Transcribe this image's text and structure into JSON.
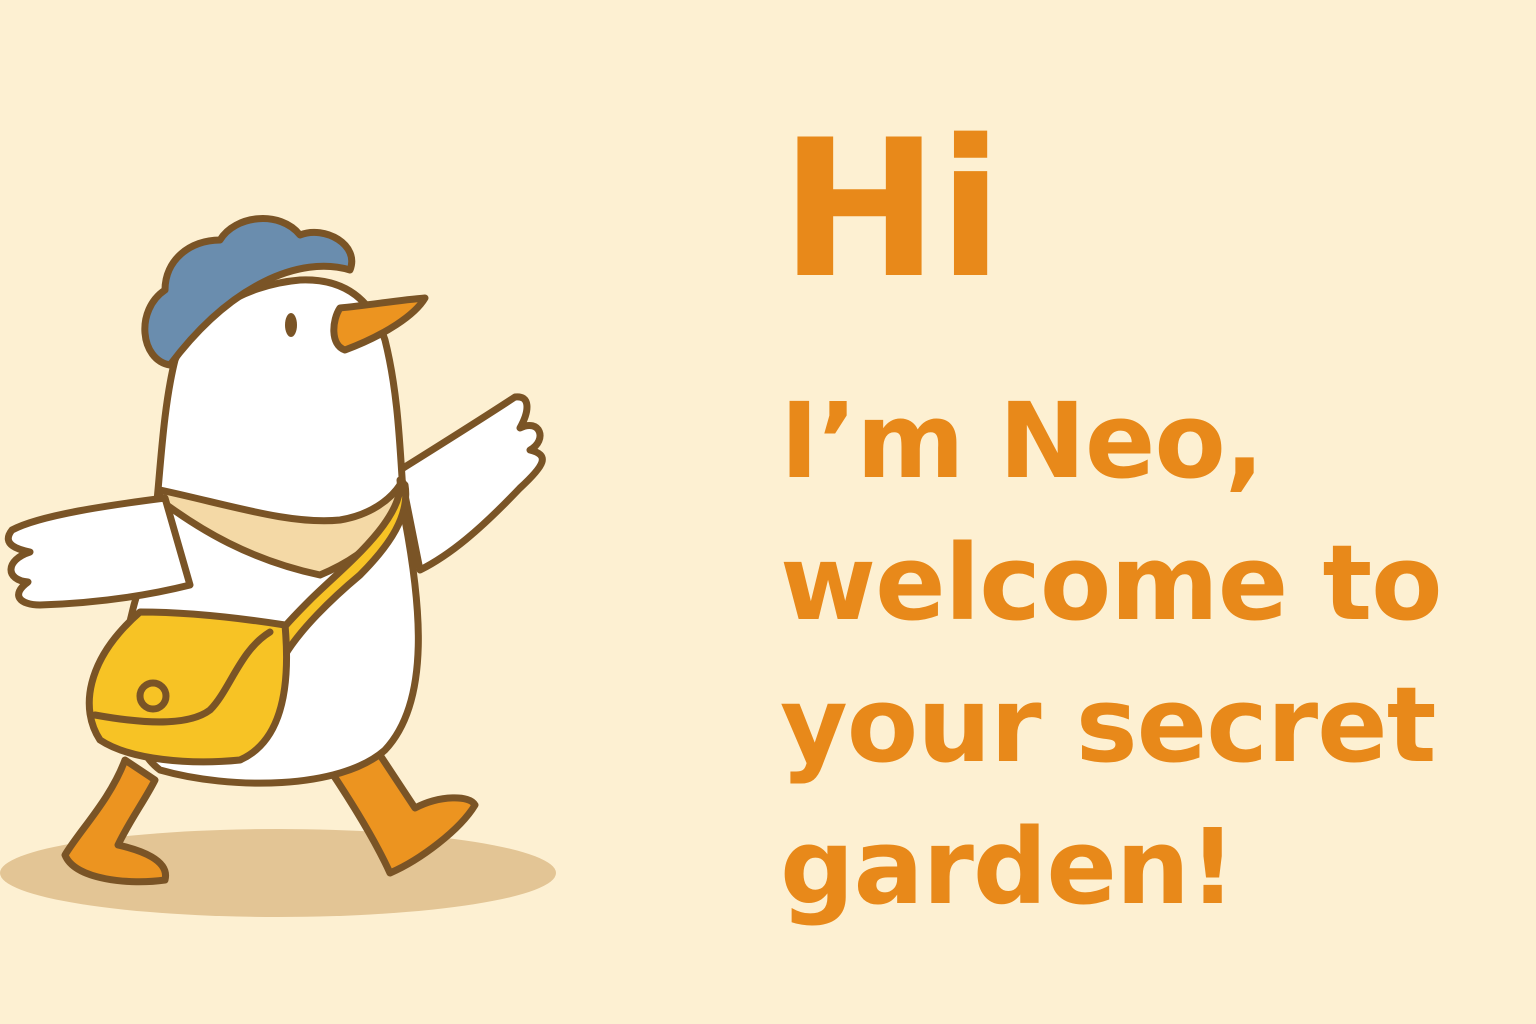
{
  "greeting": {
    "hi": "Hi",
    "lines": [
      "I’m Neo,",
      "welcome to",
      "your secret",
      "garden!"
    ]
  },
  "illustration": {
    "subject": "duck-mascot-icon",
    "colors": {
      "background": "#FDF0D2",
      "text": "#E8891A",
      "outline": "#7A5426",
      "hat": "#6A8DAE",
      "bag": "#F7C325",
      "feet": "#EC9420",
      "scarf": "#F4D9A6",
      "shadow": "#E3C595"
    }
  }
}
